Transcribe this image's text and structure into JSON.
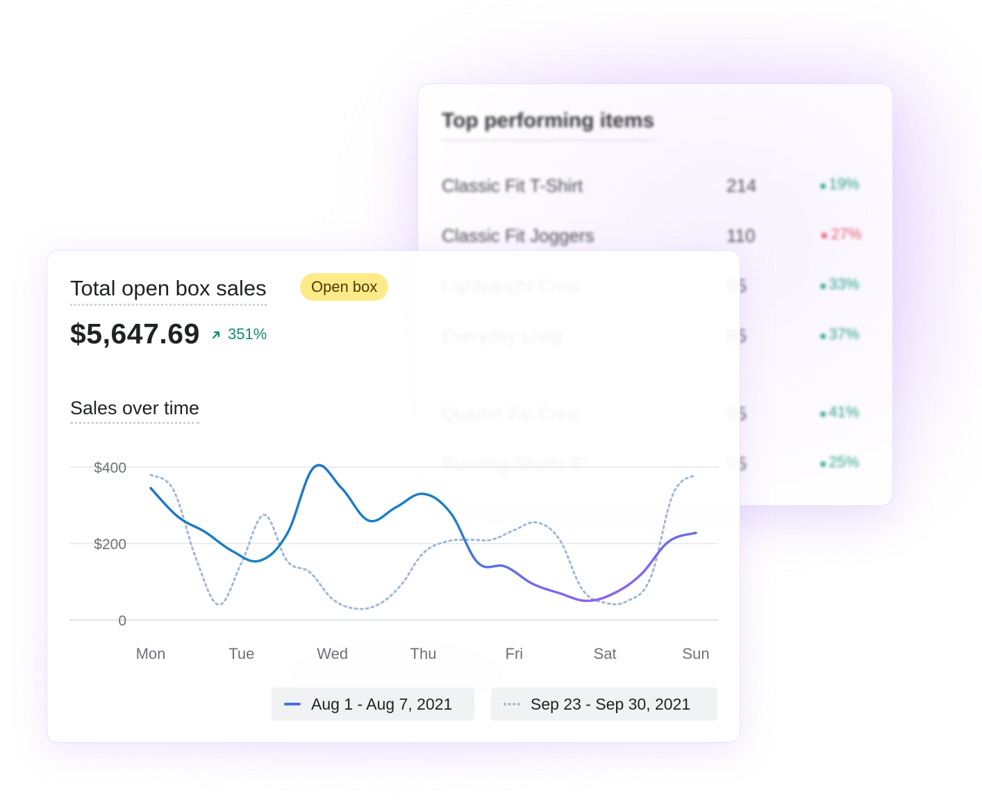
{
  "top_items_card": {
    "title": "Top performing items",
    "rows": [
      {
        "name": "Classic Fit T-Shirt",
        "count": "214",
        "change": "19%",
        "direction": "up"
      },
      {
        "name": "Classic Fit Joggers",
        "count": "110",
        "change": "27%",
        "direction": "down"
      },
      {
        "name": "Lightweight Crew",
        "count": "95",
        "change": "33%",
        "direction": "up"
      },
      {
        "name": "Everyday Long",
        "count": "95",
        "change": "37%",
        "direction": "up"
      },
      {
        "name": "Quarter Zip Crew",
        "count": "95",
        "change": "41%",
        "direction": "up"
      },
      {
        "name": "Running Shorts 6\"",
        "count": "95",
        "change": "25%",
        "direction": "up"
      }
    ]
  },
  "sales_card": {
    "title": "Total open box sales",
    "badge": "Open box",
    "amount": "$5,647.69",
    "delta": "351%",
    "delta_icon": "arrow-up-right-icon",
    "chart_title": "Sales over time"
  },
  "colors": {
    "badge_bg": "#ffea8a",
    "positive": "#108a6e",
    "series_primary_start": "#2179c9",
    "series_primary_end": "#9d5ff2",
    "series_compare": "#9fb7d6"
  },
  "chart_data": {
    "type": "line",
    "title": "Sales over time",
    "categories": [
      "Mon",
      "Tue",
      "Wed",
      "Thu",
      "Fri",
      "Sat",
      "Sun"
    ],
    "x": [
      0,
      0.25,
      0.5,
      0.75,
      1,
      1.25,
      1.5,
      1.75,
      2,
      2.25,
      2.5,
      2.75,
      3,
      3.25,
      3.5,
      3.75,
      4,
      4.25,
      4.5,
      4.75,
      5,
      5.25,
      5.5,
      5.75,
      6
    ],
    "yticks": [
      "$400",
      "$200",
      "0"
    ],
    "ylim": [
      0,
      400
    ],
    "grid": true,
    "series": [
      {
        "name": "Aug 1 - Aug 7, 2021",
        "style": "solid",
        "values": [
          345,
          270,
          230,
          180,
          155,
          225,
          400,
          345,
          260,
          295,
          330,
          280,
          150,
          140,
          95,
          70,
          50,
          70,
          120,
          205,
          228
        ]
      },
      {
        "name": "Sep 23 - Sep 30, 2021",
        "style": "dotted",
        "values": [
          380,
          340,
          160,
          40,
          150,
          275,
          155,
          125,
          55,
          30,
          40,
          90,
          175,
          205,
          210,
          210,
          235,
          255,
          210,
          80,
          45,
          50,
          110,
          330,
          380
        ]
      }
    ],
    "legend": "bottom-right"
  }
}
